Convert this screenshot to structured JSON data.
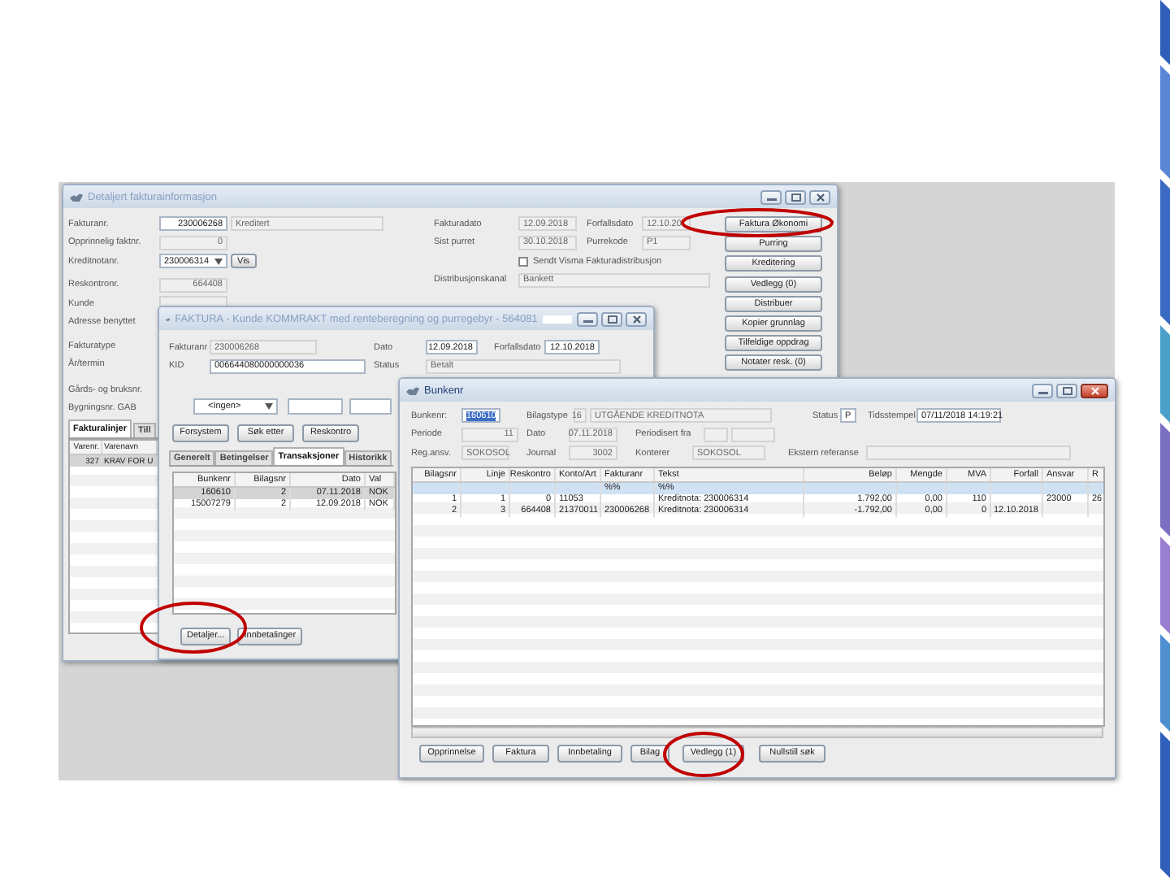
{
  "invoice_window": {
    "title": "Detaljert fakturainformasjon",
    "active": false,
    "left_fields": [
      {
        "kind": "text",
        "label": "Fakturanr.",
        "boxes": [
          {
            "text": "230006268",
            "readonly": false
          },
          {
            "text": "Kreditert",
            "readonly": true
          }
        ]
      },
      {
        "kind": "text",
        "label": "Opprinnelig faktnr.",
        "boxes": [
          {
            "text": "0",
            "readonly": true
          }
        ]
      },
      {
        "kind": "dropdown",
        "label": "Kreditnotanr.",
        "boxes": [
          {
            "text": "230006314",
            "readonly": false
          }
        ],
        "button": "Vis"
      },
      {
        "kind": "text",
        "label": "Reskontronr.",
        "boxes": [
          {
            "text": "664408",
            "readonly": true
          }
        ]
      },
      {
        "kind": "text",
        "label": "Kunde",
        "boxes": [
          {
            "readonly": true
          }
        ]
      },
      {
        "kind": "text",
        "label": "Adresse benyttet"
      },
      {
        "kind": "text",
        "label": "Fakturatype"
      },
      {
        "kind": "text",
        "label": "År/termin"
      },
      {
        "kind": "text",
        "label": "Gårds- og bruksnr."
      },
      {
        "kind": "text",
        "label": "Bygningsnr. GAB"
      }
    ],
    "right_fields": [
      {
        "label": "Fakturadato",
        "boxes": [
          {
            "text": "12.09.2018",
            "readonly": true
          }
        ]
      },
      {
        "label": "Forfallsdato",
        "boxes": [
          {
            "text": "12.10.20",
            "readonly": true
          }
        ]
      },
      {
        "label": "Sist purret",
        "boxes": [
          {
            "text": "30.10.2018",
            "readonly": true
          }
        ]
      },
      {
        "label": "Purrekode",
        "boxes": [
          {
            "text": "P1",
            "readonly": true
          }
        ]
      }
    ],
    "checkbox": {
      "label": "Sendt Visma Fakturadistribusjon",
      "checked": false
    },
    "channel": {
      "label": "Distribusjonskanal",
      "boxes": [
        {
          "text": "Bankett",
          "readonly": true
        }
      ]
    },
    "buttons": [
      "Faktura Økonomi",
      "Purring",
      "Kreditering",
      "Vedlegg (0)",
      "Distribuer",
      "Kopier grunnlag",
      "Tilfeldige oppdrag",
      "Notater resk. (0)"
    ],
    "tabs": [
      {
        "label": "Fakturalinjer",
        "selected": true
      },
      {
        "label": "Till",
        "selected": false
      }
    ],
    "table": {
      "columns": [
        "Varenr.",
        "Varenavn"
      ],
      "rows": [
        {
          "cells": [
            "327",
            "KRAV FOR U"
          ],
          "selected": true
        }
      ]
    }
  },
  "faktura_window": {
    "title": "FAKTURA - Kunde KOMMRAKT med renteberegning og purregebyr - 564081",
    "redacted": true,
    "active": false,
    "fields": [
      {
        "label": "Fakturanr",
        "boxes": [
          {
            "text": "230006268",
            "readonly": true
          }
        ]
      },
      {
        "label": "Dato",
        "boxes": [
          {
            "text": "12.09.2018",
            "readonly": false
          }
        ]
      },
      {
        "label": "Forfallsdato",
        "boxes": [
          {
            "text": "12.10.2018",
            "readonly": false
          }
        ]
      },
      {
        "label": "KID",
        "boxes": [
          {
            "text": "006644080000000036",
            "readonly": false
          }
        ]
      },
      {
        "label": "Status",
        "boxes": [
          {
            "text": "Betalt",
            "readonly": true
          }
        ]
      }
    ],
    "filters": [
      {
        "kind": "dropdown",
        "text": "<Ingen>"
      },
      {
        "kind": "text"
      },
      {
        "kind": "text"
      }
    ],
    "buttons": [
      "Forsystem",
      "Søk etter",
      "Reskontro"
    ],
    "tabs": [
      {
        "label": "Generelt",
        "selected": false
      },
      {
        "label": "Betingelser",
        "selected": false
      },
      {
        "label": "Transaksjoner",
        "selected": true
      },
      {
        "label": "Historikk",
        "selected": false
      }
    ],
    "table": {
      "columns": [
        "Bunkenr",
        "Bilagsnr",
        "Dato",
        "Val"
      ],
      "rows": [
        {
          "cells": [
            "160610",
            "2",
            "07.11.2018",
            "NOK"
          ],
          "selected": true
        },
        {
          "cells": [
            "15007279",
            "2",
            "12.09.2018",
            "NOK"
          ],
          "selected": false
        }
      ]
    },
    "bottom_buttons": [
      "Detaljer...",
      "Innbetalinger"
    ]
  },
  "bunke_window": {
    "title": "Bunkenr",
    "active": true,
    "fields": [
      {
        "label": "Bunkenr:",
        "boxes": [
          {
            "text": "160610",
            "readonly": false,
            "text_selected": true
          }
        ]
      },
      {
        "label": "Bilagstype",
        "boxes": [
          {
            "text": "16",
            "readonly": true
          },
          {
            "text": "UTGÅENDE KREDITNOTA",
            "readonly": true
          }
        ]
      },
      {
        "label": "Status",
        "boxes": [
          {
            "text": "P",
            "readonly": false
          }
        ]
      },
      {
        "label": "Tidsstempel",
        "boxes": [
          {
            "text": "07/11/2018 14:19:21",
            "readonly": false
          }
        ]
      },
      {
        "label": "Periode",
        "boxes": [
          {
            "text": "11",
            "readonly": true
          }
        ]
      },
      {
        "label": "Dato",
        "boxes": [
          {
            "text": "07.11.2018",
            "readonly": true
          }
        ]
      },
      {
        "label": "Periodisert fra",
        "boxes": [
          {
            "readonly": true
          },
          {
            "readonly": true
          }
        ]
      },
      {
        "label": "Reg.ansv.",
        "boxes": [
          {
            "text": "SOKOSOL",
            "readonly": true
          }
        ]
      },
      {
        "label": "Journal",
        "boxes": [
          {
            "text": "3002",
            "readonly": true
          }
        ]
      },
      {
        "label": "Konterer",
        "boxes": [
          {
            "text": "SOKOSOL",
            "readonly": true
          }
        ]
      },
      {
        "label": "Ekstern referanse",
        "boxes": [
          {
            "readonly": true
          }
        ]
      }
    ],
    "table": {
      "columns": [
        {
          "label": "Bilagsnr"
        },
        {
          "label": "Linje"
        },
        {
          "label": "Reskontro"
        },
        {
          "label": "Konto/Art"
        },
        {
          "label": "Fakturanr",
          "filter": "%%"
        },
        {
          "label": "Tekst",
          "filter": "%%"
        },
        {
          "label": "Beløp"
        },
        {
          "label": "Mengde"
        },
        {
          "label": "MVA"
        },
        {
          "label": "Forfall"
        },
        {
          "label": "Ansvar"
        },
        {
          "label": "R"
        }
      ],
      "rows": [
        {
          "bilagsnr": "1",
          "linje": "1",
          "reskontro": "0",
          "konto_art": "11053",
          "tekst": "Kreditnota: 230006314",
          "belop": "1.792,00",
          "mengde": "0,00",
          "mva": "110",
          "ansvar": "23000",
          "r": "26"
        },
        {
          "bilagsnr": "2",
          "linje": "3",
          "reskontro": "664408",
          "konto_art": "21370011",
          "fakturanr": "230006268",
          "tekst": "Kreditnota: 230006314",
          "belop": "-1.792,00",
          "mengde": "0,00",
          "mva": "0",
          "forfall": "12.10.2018"
        }
      ]
    },
    "buttons": [
      "Opprinnelse",
      "Faktura",
      "Innbetaling",
      "Bilag",
      "Vedlegg (1)",
      "Nullstill søk"
    ]
  },
  "annotations": [
    {
      "kind": "ellipse"
    },
    {
      "kind": "ellipse"
    },
    {
      "kind": "ellipse"
    }
  ]
}
